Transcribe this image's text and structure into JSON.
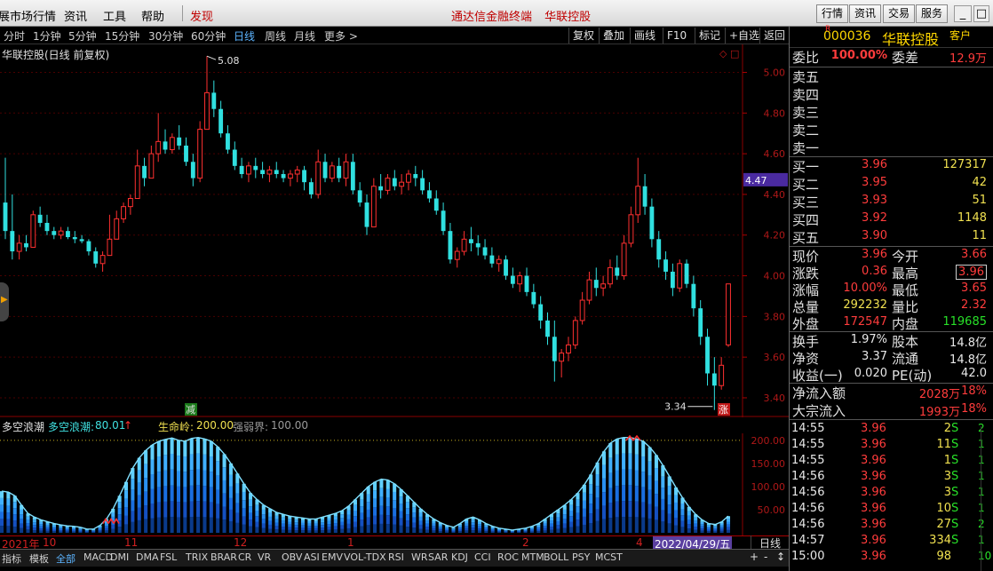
{
  "menu": {
    "items": [
      "展市场行情",
      "资讯",
      "工具",
      "帮助"
    ],
    "discover": "发现",
    "center_links": [
      "通达信金融终端",
      "华联控股"
    ],
    "right_buttons": [
      "行情",
      "资讯",
      "交易",
      "服务"
    ],
    "win_controls": [
      "_",
      "□",
      "×"
    ]
  },
  "periods": [
    "分时",
    "1分钟",
    "5分钟",
    "15分钟",
    "30分钟",
    "60分钟",
    "日线",
    "周线",
    "月线",
    "更多 >"
  ],
  "active_period": "日线",
  "toolbar_right": [
    "复权",
    "叠加",
    "画线",
    "F10",
    "标记",
    "+自选",
    "返回"
  ],
  "chart_title": "华联控股(日线 前复权)",
  "chart_markers": {
    "high_label": "5.08",
    "low_label": "3.34",
    "price_flag": "4.47",
    "jian": "减",
    "zhang": "涨",
    "corner": "◇ □"
  },
  "indicator_bar": {
    "name": "多空浪潮",
    "series_label": "多空浪潮:",
    "series_value": "80.01",
    "arrow": "↑",
    "life_label": "生命岭:",
    "life_value": "200.00",
    "weak_label": "强弱界:",
    "weak_value": "100.00"
  },
  "dates": {
    "labels": [
      "2021年",
      "10",
      "11",
      "12",
      "1",
      "2",
      "3",
      "4"
    ],
    "cursor": "2022/04/29/五",
    "period": "日线"
  },
  "tabs": [
    "指标",
    "模板",
    "全部",
    "MACD",
    "DMI",
    "DMA",
    "FSL",
    "TRIX",
    "BRAR",
    "CR",
    "VR",
    "OBV",
    "ASI",
    "EMV",
    "VOL-TDX",
    "RSI",
    "WR",
    "SAR",
    "KDJ",
    "CCI",
    "ROC",
    "MTM",
    "BOLL",
    "PSY",
    "MCST"
  ],
  "active_tab": "全部",
  "tab_controls": [
    "+",
    "-",
    "↕"
  ],
  "side_handle": "▶",
  "stock": {
    "flag": "R",
    "code": "000036",
    "name": "华联控股",
    "cust": "客户"
  },
  "committee": {
    "ratio_label": "委比",
    "ratio": "100.00%",
    "diff_label": "委差",
    "diff": "12.9万"
  },
  "sell_levels": [
    "卖五",
    "卖四",
    "卖三",
    "卖二",
    "卖一"
  ],
  "buy_levels": [
    {
      "label": "买一",
      "price": "3.96",
      "vol": "127317"
    },
    {
      "label": "买二",
      "price": "3.95",
      "vol": "42"
    },
    {
      "label": "买三",
      "price": "3.93",
      "vol": "51"
    },
    {
      "label": "买四",
      "price": "3.92",
      "vol": "1148"
    },
    {
      "label": "买五",
      "price": "3.90",
      "vol": "11"
    }
  ],
  "quote_rows": [
    {
      "l1": "现价",
      "v1": "3.96",
      "c1": "red",
      "l2": "今开",
      "v2": "3.66",
      "c2": "red"
    },
    {
      "l1": "涨跌",
      "v1": "0.36",
      "c1": "red",
      "l2": "最高",
      "v2": "3.96",
      "c2": "red"
    },
    {
      "l1": "涨幅",
      "v1": "10.00%",
      "c1": "red",
      "l2": "最低",
      "v2": "3.65",
      "c2": "red"
    },
    {
      "l1": "总量",
      "v1": "292232",
      "c1": "yel",
      "l2": "量比",
      "v2": "2.32",
      "c2": "red"
    },
    {
      "l1": "外盘",
      "v1": "172547",
      "c1": "red",
      "l2": "内盘",
      "v2": "119685",
      "c2": "grn"
    }
  ],
  "fund_rows": [
    {
      "l1": "换手",
      "v1": "1.97%",
      "l2": "股本",
      "v2": "14.8亿"
    },
    {
      "l1": "净资",
      "v1": "3.37",
      "l2": "流通",
      "v2": "14.8亿"
    },
    {
      "l1": "收益(一)",
      "v1": "0.020",
      "l2": "PE(动)",
      "v2": "42.0"
    }
  ],
  "flows": [
    {
      "label": "净流入额",
      "v1": "2028万",
      "v2": "18%"
    },
    {
      "label": "大宗流入",
      "v1": "1993万",
      "v2": "18%"
    }
  ],
  "ticks": [
    {
      "t": "14:55",
      "p": "3.96",
      "v": "2",
      "s": "S",
      "n": "2"
    },
    {
      "t": "14:55",
      "p": "3.96",
      "v": "11",
      "s": "S",
      "n": "1"
    },
    {
      "t": "14:55",
      "p": "3.96",
      "v": "1",
      "s": "S",
      "n": "1"
    },
    {
      "t": "14:56",
      "p": "3.96",
      "v": "3",
      "s": "S",
      "n": "1"
    },
    {
      "t": "14:56",
      "p": "3.96",
      "v": "3",
      "s": "S",
      "n": "1"
    },
    {
      "t": "14:56",
      "p": "3.96",
      "v": "10",
      "s": "S",
      "n": "1"
    },
    {
      "t": "14:56",
      "p": "3.96",
      "v": "27",
      "s": "S",
      "n": "2"
    },
    {
      "t": "14:57",
      "p": "3.96",
      "v": "334",
      "s": "S",
      "n": "1"
    },
    {
      "t": "15:00",
      "p": "3.96",
      "v": "98",
      "s": "",
      "n": "10"
    }
  ],
  "chart_data": {
    "type": "candlestick",
    "price_axis": [
      "5.00",
      "4.80",
      "4.60",
      "4.40",
      "4.20",
      "4.00",
      "3.80",
      "3.60",
      "3.40"
    ],
    "ylim": [
      3.33,
      5.12
    ],
    "sub_axis": [
      "200.00",
      "150.00",
      "100.00",
      "50.00"
    ],
    "sub_ylim": [
      0,
      215
    ],
    "candles": [
      [
        4.36,
        4.58,
        4.18,
        4.22
      ],
      [
        4.22,
        4.4,
        4.08,
        4.12
      ],
      [
        4.12,
        4.2,
        4.08,
        4.16
      ],
      [
        4.16,
        4.2,
        4.12,
        4.14
      ],
      [
        4.14,
        4.32,
        4.14,
        4.3
      ],
      [
        4.3,
        4.34,
        4.24,
        4.26
      ],
      [
        4.26,
        4.3,
        4.2,
        4.22
      ],
      [
        4.22,
        4.24,
        4.18,
        4.2
      ],
      [
        4.2,
        4.24,
        4.18,
        4.22
      ],
      [
        4.22,
        4.24,
        4.18,
        4.19
      ],
      [
        4.19,
        4.22,
        4.16,
        4.18
      ],
      [
        4.18,
        4.2,
        4.16,
        4.17
      ],
      [
        4.17,
        4.18,
        4.1,
        4.12
      ],
      [
        4.12,
        4.14,
        4.04,
        4.06
      ],
      [
        4.06,
        4.12,
        4.02,
        4.1
      ],
      [
        4.1,
        4.3,
        4.1,
        4.18
      ],
      [
        4.18,
        4.32,
        4.18,
        4.28
      ],
      [
        4.28,
        4.36,
        4.26,
        4.34
      ],
      [
        4.34,
        4.4,
        4.3,
        4.38
      ],
      [
        4.38,
        4.62,
        4.38,
        4.54
      ],
      [
        4.54,
        4.58,
        4.44,
        4.48
      ],
      [
        4.48,
        4.64,
        4.48,
        4.6
      ],
      [
        4.6,
        4.8,
        4.56,
        4.66
      ],
      [
        4.66,
        4.72,
        4.6,
        4.62
      ],
      [
        4.62,
        4.7,
        4.6,
        4.68
      ],
      [
        4.68,
        4.74,
        4.62,
        4.64
      ],
      [
        4.64,
        4.68,
        4.54,
        4.56
      ],
      [
        4.56,
        4.6,
        4.44,
        4.48
      ],
      [
        4.48,
        4.76,
        4.46,
        4.72
      ],
      [
        4.72,
        5.08,
        4.72,
        4.9
      ],
      [
        4.9,
        4.96,
        4.78,
        4.82
      ],
      [
        4.82,
        4.86,
        4.68,
        4.7
      ],
      [
        4.7,
        4.74,
        4.6,
        4.62
      ],
      [
        4.62,
        4.66,
        4.52,
        4.54
      ],
      [
        4.54,
        4.58,
        4.48,
        4.5
      ],
      [
        4.5,
        4.56,
        4.46,
        4.54
      ],
      [
        4.54,
        4.58,
        4.48,
        4.52
      ],
      [
        4.52,
        4.56,
        4.48,
        4.5
      ],
      [
        4.5,
        4.54,
        4.46,
        4.52
      ],
      [
        4.52,
        4.56,
        4.48,
        4.5
      ],
      [
        4.5,
        4.52,
        4.46,
        4.48
      ],
      [
        4.48,
        4.52,
        4.44,
        4.5
      ],
      [
        4.5,
        4.54,
        4.46,
        4.52
      ],
      [
        4.52,
        4.54,
        4.42,
        4.46
      ],
      [
        4.46,
        4.48,
        4.38,
        4.4
      ],
      [
        4.4,
        4.62,
        4.38,
        4.56
      ],
      [
        4.56,
        4.6,
        4.46,
        4.48
      ],
      [
        4.48,
        4.56,
        4.46,
        4.54
      ],
      [
        4.54,
        4.58,
        4.46,
        4.48
      ],
      [
        4.48,
        4.6,
        4.44,
        4.56
      ],
      [
        4.56,
        4.6,
        4.4,
        4.42
      ],
      [
        4.42,
        4.46,
        4.34,
        4.36
      ],
      [
        4.36,
        4.4,
        4.2,
        4.24
      ],
      [
        4.24,
        4.48,
        4.24,
        4.44
      ],
      [
        4.44,
        4.5,
        4.38,
        4.42
      ],
      [
        4.42,
        4.5,
        4.4,
        4.48
      ],
      [
        4.48,
        4.52,
        4.42,
        4.44
      ],
      [
        4.44,
        4.5,
        4.4,
        4.46
      ],
      [
        4.46,
        4.52,
        4.42,
        4.5
      ],
      [
        4.5,
        4.54,
        4.44,
        4.48
      ],
      [
        4.48,
        4.52,
        4.4,
        4.42
      ],
      [
        4.42,
        4.46,
        4.36,
        4.38
      ],
      [
        4.38,
        4.42,
        4.3,
        4.32
      ],
      [
        4.32,
        4.36,
        4.2,
        4.22
      ],
      [
        4.22,
        4.26,
        4.06,
        4.08
      ],
      [
        4.08,
        4.14,
        4.04,
        4.12
      ],
      [
        4.12,
        4.22,
        4.1,
        4.18
      ],
      [
        4.18,
        4.24,
        4.12,
        4.16
      ],
      [
        4.16,
        4.2,
        4.1,
        4.14
      ],
      [
        4.14,
        4.18,
        4.08,
        4.1
      ],
      [
        4.1,
        4.14,
        4.04,
        4.06
      ],
      [
        4.06,
        4.1,
        4.02,
        4.08
      ],
      [
        4.08,
        4.1,
        3.98,
        4.0
      ],
      [
        4.0,
        4.04,
        3.94,
        3.96
      ],
      [
        3.96,
        4.02,
        3.92,
        4.0
      ],
      [
        4.0,
        4.04,
        3.9,
        3.92
      ],
      [
        3.92,
        3.96,
        3.84,
        3.86
      ],
      [
        3.86,
        3.9,
        3.74,
        3.78
      ],
      [
        3.78,
        3.82,
        3.66,
        3.7
      ],
      [
        3.7,
        3.78,
        3.48,
        3.58
      ],
      [
        3.58,
        3.64,
        3.5,
        3.62
      ],
      [
        3.62,
        3.7,
        3.58,
        3.66
      ],
      [
        3.66,
        3.8,
        3.64,
        3.78
      ],
      [
        3.78,
        3.92,
        3.76,
        3.88
      ],
      [
        3.88,
        4.02,
        3.86,
        3.98
      ],
      [
        3.98,
        4.04,
        3.9,
        3.94
      ],
      [
        3.94,
        4.0,
        3.9,
        3.96
      ],
      [
        3.96,
        4.08,
        3.94,
        4.04
      ],
      [
        4.04,
        4.1,
        3.98,
        4.0
      ],
      [
        4.0,
        4.2,
        3.98,
        4.16
      ],
      [
        4.16,
        4.34,
        4.14,
        4.3
      ],
      [
        4.3,
        4.58,
        4.26,
        4.44
      ],
      [
        4.44,
        4.5,
        4.3,
        4.34
      ],
      [
        4.34,
        4.38,
        4.14,
        4.18
      ],
      [
        4.18,
        4.22,
        4.04,
        4.08
      ],
      [
        4.08,
        4.12,
        3.98,
        4.02
      ],
      [
        4.02,
        4.06,
        3.9,
        3.94
      ],
      [
        3.94,
        4.08,
        3.92,
        4.06
      ],
      [
        4.06,
        4.08,
        3.94,
        3.96
      ],
      [
        3.96,
        4.0,
        3.8,
        3.84
      ],
      [
        3.84,
        3.88,
        3.66,
        3.7
      ],
      [
        3.7,
        3.74,
        3.46,
        3.52
      ],
      [
        3.52,
        3.6,
        3.34,
        3.46
      ],
      [
        3.46,
        3.6,
        3.44,
        3.56
      ],
      [
        3.66,
        3.96,
        3.65,
        3.96
      ]
    ],
    "wave": [
      90,
      88,
      80,
      60,
      42,
      34,
      28,
      24,
      20,
      17,
      15,
      14,
      12,
      8,
      8,
      16,
      30,
      52,
      80,
      110,
      140,
      162,
      178,
      190,
      198,
      202,
      205,
      200,
      198,
      204,
      206,
      203,
      198,
      186,
      170,
      150,
      128,
      106,
      86,
      72,
      60,
      52,
      44,
      40,
      36,
      34,
      32,
      30,
      30,
      34,
      38,
      42,
      48,
      58,
      72,
      86,
      100,
      110,
      116,
      114,
      106,
      94,
      80,
      66,
      52,
      40,
      30,
      22,
      16,
      12,
      20,
      30,
      34,
      28,
      20,
      14,
      10,
      8,
      6,
      8,
      10,
      14,
      20,
      30,
      40,
      50,
      60,
      72,
      86,
      104,
      126,
      152,
      176,
      194,
      203,
      206,
      206,
      203,
      198,
      185,
      168,
      146,
      122,
      98,
      76,
      56,
      40,
      28,
      20,
      18,
      24,
      36
    ]
  }
}
